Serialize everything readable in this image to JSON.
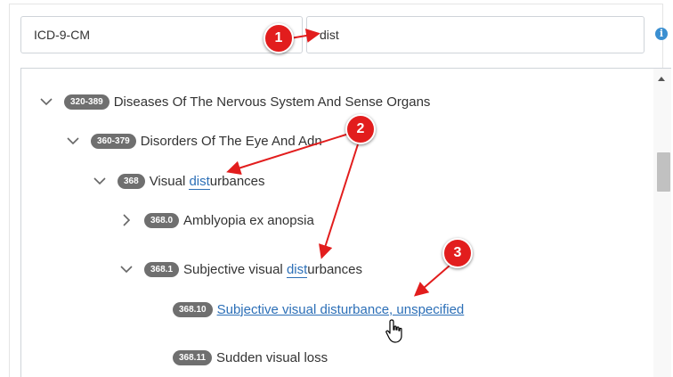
{
  "code_system": {
    "value": "ICD-9-CM"
  },
  "search": {
    "value": "dist"
  },
  "info_icon": {
    "glyph": "i"
  },
  "tree": {
    "rows": [
      {
        "code": "320-389",
        "label": "Diseases Of The Nervous System And Sense Organs",
        "expanded": true
      },
      {
        "code": "360-379",
        "label_pre": "Disorders Of The Eye And Adn",
        "expanded": true
      },
      {
        "code": "368",
        "label_pre": "Visual ",
        "label_hl": "dist",
        "label_post": "urbances",
        "expanded": true
      },
      {
        "code": "368.0",
        "label": "Amblyopia ex anopsia",
        "expanded": false
      },
      {
        "code": "368.1",
        "label_pre": "Subjective visual ",
        "label_hl": "dist",
        "label_post": "urbances",
        "expanded": true
      },
      {
        "code": "368.10",
        "label_pre": "Subjective visual ",
        "label_hl": "dist",
        "label_post": "urbance, unspecified"
      },
      {
        "code": "368.11",
        "label": "Sudden visual loss"
      }
    ]
  },
  "callouts": [
    "1",
    "2",
    "3"
  ],
  "colors": {
    "callout": "#e21d1d",
    "link": "#2c6fb7",
    "badge": "#6f6f6f"
  }
}
